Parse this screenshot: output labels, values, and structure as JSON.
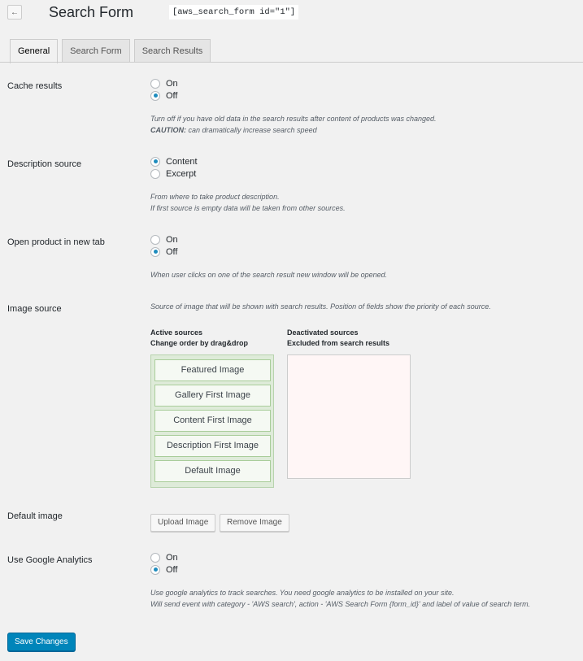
{
  "header": {
    "back_icon": "←",
    "title": "Search Form",
    "shortcode": "[aws_search_form id=\"1\"]"
  },
  "tabs": [
    {
      "label": "General",
      "active": true
    },
    {
      "label": "Search Form",
      "active": false
    },
    {
      "label": "Search Results",
      "active": false
    }
  ],
  "cache": {
    "label": "Cache results",
    "options": [
      {
        "label": "On",
        "checked": false
      },
      {
        "label": "Off",
        "checked": true
      }
    ],
    "desc_line1": "Turn off if you have old data in the search results after content of products was changed.",
    "desc_caution": "CAUTION:",
    "desc_line2": " can dramatically increase search speed"
  },
  "description_source": {
    "label": "Description source",
    "options": [
      {
        "label": "Content",
        "checked": true
      },
      {
        "label": "Excerpt",
        "checked": false
      }
    ],
    "desc_line1": "From where to take product description.",
    "desc_line2": "If first source is empty data will be taken from other sources."
  },
  "new_tab": {
    "label": "Open product in new tab",
    "options": [
      {
        "label": "On",
        "checked": false
      },
      {
        "label": "Off",
        "checked": true
      }
    ],
    "desc": "When user clicks on one of the search result new window will be opened."
  },
  "image_source": {
    "label": "Image source",
    "desc": "Source of image that will be shown with search results. Position of fields show the priority of each source.",
    "active_title": "Active sources",
    "active_sub": "Change order by drag&drop",
    "deactivated_title": "Deactivated sources",
    "deactivated_sub": "Excluded from search results",
    "active_items": [
      "Featured Image",
      "Gallery First Image",
      "Content First Image",
      "Description First Image",
      "Default Image"
    ]
  },
  "default_image": {
    "label": "Default image",
    "upload_label": "Upload Image",
    "remove_label": "Remove Image"
  },
  "analytics": {
    "label": "Use Google Analytics",
    "options": [
      {
        "label": "On",
        "checked": false
      },
      {
        "label": "Off",
        "checked": true
      }
    ],
    "desc_line1": "Use google analytics to track searches. You need google analytics to be installed on your site.",
    "desc_line2": "Will send event with category - 'AWS search', action - 'AWS Search Form {form_id}' and label of value of search term."
  },
  "save_label": "Save Changes",
  "colors": {
    "primary": "#0085ba",
    "radio_checked": "#1e8cbe",
    "active_box": "#deebd9",
    "deactivated_box": "#fff6f6"
  }
}
